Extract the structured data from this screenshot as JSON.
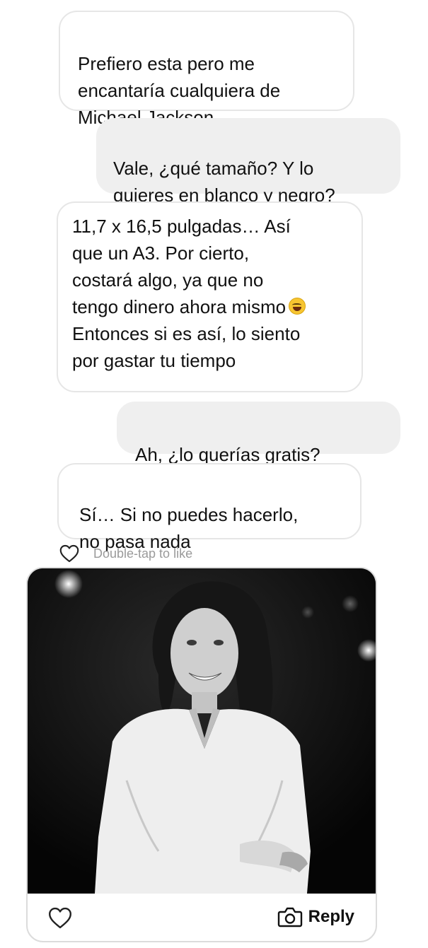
{
  "messages": [
    {
      "side": "received",
      "text": "Prefiero esta pero me\nencantaría cualquiera de\nMichael Jackson"
    },
    {
      "side": "sent",
      "text": "Vale, ¿qué tamaño? Y lo\nquieres en blanco y negro?"
    },
    {
      "side": "received",
      "text_before_emoji": "11,7 x 16,5 pulgadas… Así\nque un A3. Por cierto,\ncostará algo, ya que no\ntengo dinero ahora mismo",
      "emoji": "grinning-sweat-emoji",
      "text_after_emoji": "\nEntonces si es así, lo siento\npor gastar tu tiempo"
    },
    {
      "side": "sent",
      "text": "Ah, ¿lo querías gratis?"
    },
    {
      "side": "received",
      "text": "Sí… Si no puedes hacerlo,\nno pasa nada"
    }
  ],
  "like_hint": {
    "icon": "heart-outline-icon",
    "text": "Double-tap to like"
  },
  "shared_post": {
    "photo": "black-and-white photo of a smiling man with curly hair in a white shirt on a dark stage",
    "like_icon": "heart-outline-icon",
    "reply_icon": "camera-icon",
    "reply_label": "Reply"
  },
  "colors": {
    "sent_bubble": "#efefef",
    "received_border": "#e6e6e6",
    "hint_text": "#9a9a9a"
  }
}
